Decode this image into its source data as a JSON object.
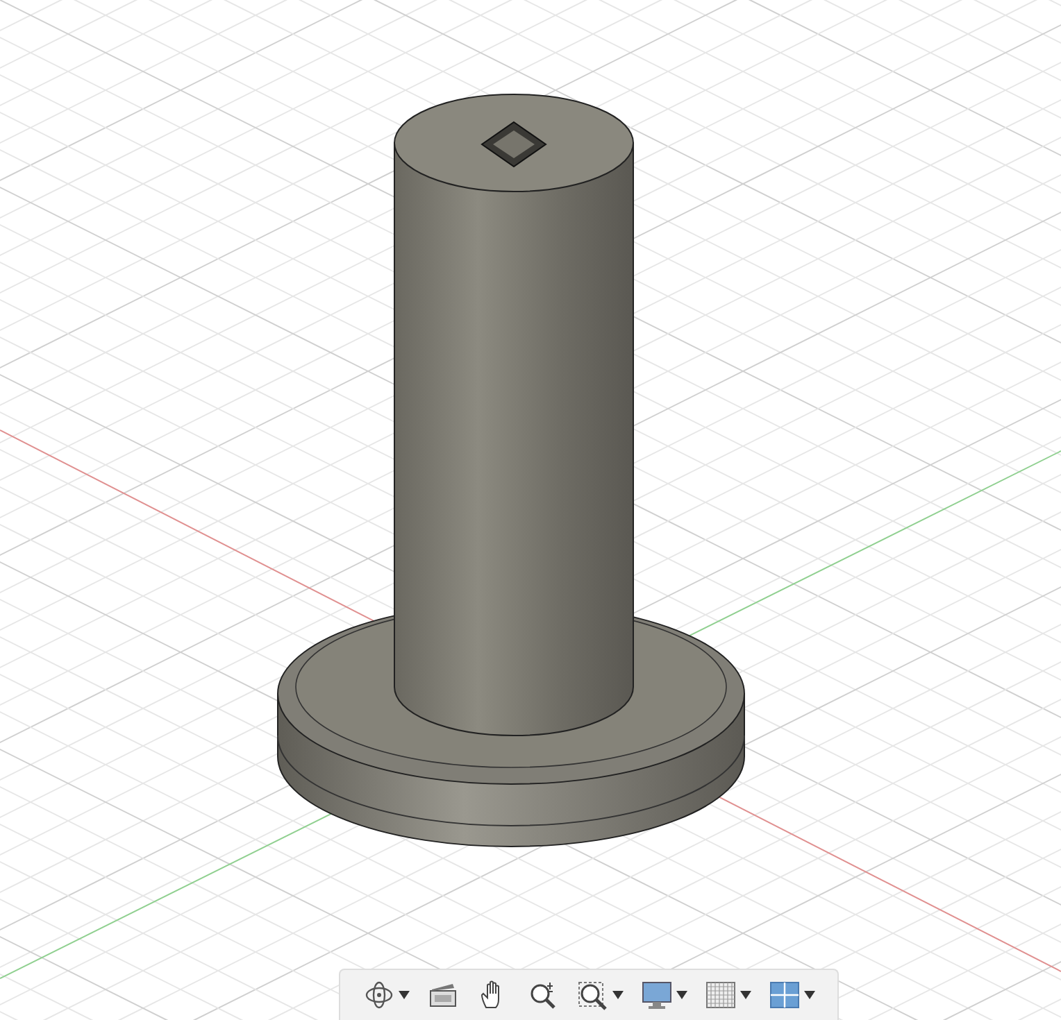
{
  "toolbar": {
    "items": [
      {
        "kind": "orbit",
        "dropdown": true
      },
      {
        "kind": "look-at",
        "dropdown": false
      },
      {
        "kind": "pan",
        "dropdown": false
      },
      {
        "kind": "zoom",
        "dropdown": false
      },
      {
        "kind": "fit",
        "dropdown": true
      },
      {
        "kind": "display",
        "dropdown": true
      },
      {
        "kind": "grid",
        "dropdown": true
      },
      {
        "kind": "viewports",
        "dropdown": true
      }
    ]
  }
}
